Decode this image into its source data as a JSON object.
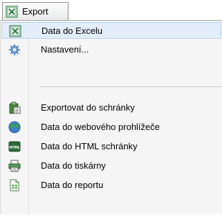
{
  "menu": {
    "button_label": "Export",
    "items": [
      {
        "label": "Data do Excelu",
        "icon": "excel-icon"
      },
      {
        "label": "Nastavení...",
        "icon": "gear-icon"
      },
      {
        "label": "Exportovat do schránky",
        "icon": "clipboard-icon"
      },
      {
        "label": "Data do webového prohlížeče",
        "icon": "globe-icon"
      },
      {
        "label": "Data do HTML schránky",
        "icon": "html-icon"
      },
      {
        "label": "Data do tiskárny",
        "icon": "printer-icon"
      },
      {
        "label": "Data do reportu",
        "icon": "report-icon"
      }
    ]
  },
  "colors": {
    "highlight": "#e3eefa",
    "excel_green": "#1e7a3a",
    "gear_blue": "#5b8fd6",
    "globe_green": "#3aa34a",
    "globe_blue": "#3b7fd0"
  }
}
